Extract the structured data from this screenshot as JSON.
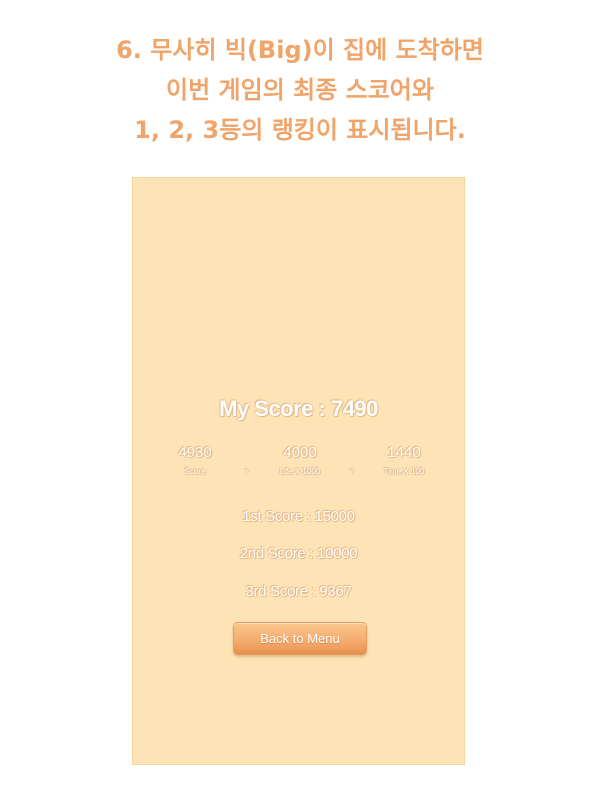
{
  "caption": {
    "lines": [
      "6. 무사히 빅(Big)이 집에 도착하면",
      "이번 게임의 최종 스코어와",
      "1, 2, 3등의 랭킹이 표시됩니다."
    ]
  },
  "result": {
    "my_score": "My Score : 7490",
    "breakdown": [
      {
        "value": "4930",
        "label": "Score"
      },
      {
        "value": "4000",
        "label": "Life X 1000"
      },
      {
        "value": "1440",
        "label": "Time X 100"
      }
    ],
    "operators": [
      "+",
      "+"
    ]
  },
  "ranking": [
    "1st Score : 15000",
    "2nd Score : 10000",
    "3rd Score : 9367"
  ],
  "back_button": "Back to Menu",
  "colors": {
    "caption": "#f0a46a",
    "panel_background": "#fde3b5",
    "button": "#f2a567",
    "text": "#ffffff"
  }
}
